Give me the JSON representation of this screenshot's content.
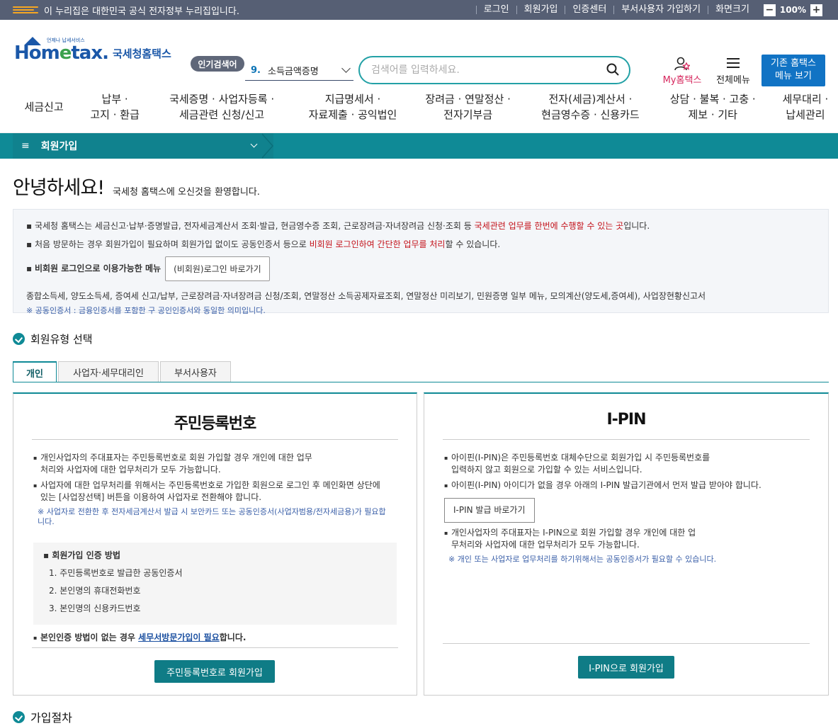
{
  "topbar": {
    "notice": "이 누리집은 대한민국 공식 전자정부 누리집입니다.",
    "links": [
      "로그인",
      "회원가입",
      "인증센터",
      "부서사용자 가입하기"
    ],
    "zoom_label": "화면크기",
    "zoom_value": "100%",
    "zoom_minus": "−",
    "zoom_plus": "+"
  },
  "header": {
    "logo_small": "언제나 납세서비스",
    "logo_brand_a": "Hom",
    "logo_brand_e": "e",
    "logo_brand_b": "tax.",
    "logo_kr": "국세청홈택스",
    "popular_label": "인기검색어",
    "popular_num": "9.",
    "popular_term": "소득금액증명",
    "search_placeholder": "검색어를 입력하세요.",
    "my_label": "My홈택스",
    "allmenu_label": "전체메뉴",
    "old_btn_line1": "기존 홈택스",
    "old_btn_line2": "메뉴 보기"
  },
  "gnb": [
    {
      "l1": "세금신고",
      "l2": ""
    },
    {
      "l1": "납부 ·",
      "l2": "고지 · 환급"
    },
    {
      "l1": "국세증명 · 사업자등록 ·",
      "l2": "세금관련 신청/신고"
    },
    {
      "l1": "지급명세서 ·",
      "l2": "자료제출 · 공익법인"
    },
    {
      "l1": "장려금 · 연말정산 ·",
      "l2": "전자기부금"
    },
    {
      "l1": "전자(세금)계산서 ·",
      "l2": "현금영수증 · 신용카드"
    },
    {
      "l1": "상담 · 불복 · 고충 ·",
      "l2": "제보 · 기타"
    },
    {
      "l1": "세무대리 ·",
      "l2": "납세관리"
    }
  ],
  "subnav": {
    "label": "회원가입",
    "ham": "≡"
  },
  "greet": {
    "title": "안녕하세요!",
    "sub": "국세청 홈택스에 오신것을 환영합니다."
  },
  "info": {
    "p1a": "국세청 홈택스는 세금신고·납부·증명발급, 전자세금계산서 조회·발급, 현금영수증 조회, 근로장려금·자녀장려금 신청·조회 등 ",
    "p1b": "국세관련 업무를 한번에 수행할 수 있는 곳",
    "p1c": "입니다.",
    "p2a": "처음 방문하는 경우 회원가입이 필요하며 회원가입 없이도 공동인증서 등으로 ",
    "p2b": "비회원 로그인하여 간단한 업무를 처리",
    "p2c": "할 수 있습니다.",
    "p3": "비회원 로그인으로 이용가능한 메뉴",
    "p3btn": "(비회원)로그인 바로가기",
    "p4": "종합소득세, 양도소득세, 증여세 신고/납부, 근로장려금·자녀장려금 신청/조회, 연말정산 소득공제자료조회, 연말정산 미리보기, 민원증명 일부 메뉴, 모의계산(양도세,증여세), 사업장현황신고서",
    "note": "※ 공동인증서 : 금융인증서를 포함한 구 공인인증서와 동일한 의미입니다."
  },
  "sec1": "회원유형 선택",
  "tabs": [
    "개인",
    "사업자·세무대리인",
    "부서사용자"
  ],
  "left": {
    "title": "주민등록번호",
    "p1": "개인사업자의 주대표자는 주민등록번호로 회원 가입할 경우 개인에 대한 업무처리와 사업자에 대한 업무처리가 모두 가능합니다.",
    "p2": "사업자에 대한 업무처리를 위해서는 주민등록번호로 가입한 회원으로 로그인 후 메인화면 상단에 있는 [사업장선택] 버튼을 이용하여 사업자로 전환해야 합니다.",
    "note": "※ 사업자로 전환한 후 전자세금계산서 발급 시 보안카드 또는 공동인증서(사업자범용/전자세금용)가 필요합니다.",
    "methods_title": "회원가입 인증 방법",
    "methods": [
      "1. 주민등록번호로 발급한 공동인증서",
      "2. 본인명의 휴대전화번호",
      "3. 본인명의 신용카드번호"
    ],
    "p3a": "본인인증 방법이 없는 경우 ",
    "p3link": "세무서방문가입이 필요",
    "p3b": "합니다.",
    "btn": "주민등록번호로 회원가입"
  },
  "right": {
    "title": "I-PIN",
    "p1": "아이핀(I-PIN)은 주민등록번호 대체수단으로 회원가입 시 주민등록번호를 입력하지 않고 회원으로 가입할 수 있는 서비스입니다.",
    "p2": "아이핀(I-PIN) 아이디가 없을 경우 아래의 I-PIN 발급기관에서 먼저 발급 받아야 합니다.",
    "issue_btn": "I-PIN 발급 바로가기",
    "p3": "개인사업자의 주대표자는 I-PIN으로 회원 가입할 경우 개인에 대한 업무처리와 사업자에 대한 업무처리가 모두 가능합니다.",
    "note": "※ 개인 또는 사업자로 업무처리를 하기위해서는 공동인증서가 필요할 수 있습니다.",
    "btn": "I-PIN으로 회원가입"
  },
  "sec2": "가입절차"
}
